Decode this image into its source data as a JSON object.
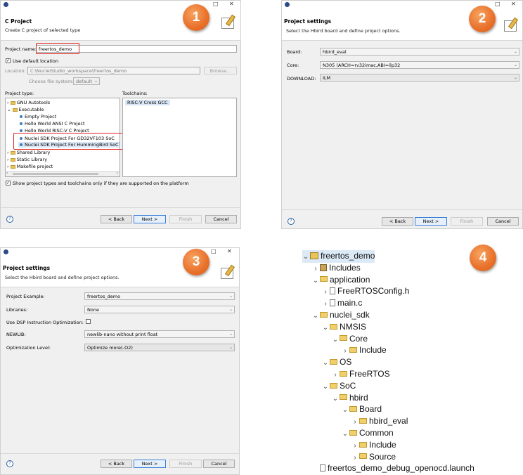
{
  "badges": [
    "1",
    "2",
    "3",
    "4"
  ],
  "window_buttons": {
    "minimize": "□",
    "close": "✕"
  },
  "panel1": {
    "title": "C Project",
    "description": "Create C project of selected type",
    "project_name_label": "Project name:",
    "project_name_value": "freertos_demo",
    "use_default_location_label": "Use default location",
    "use_default_location_checked": true,
    "location_label": "Location:",
    "location_value": "C:\\NucleiStudio_workspace\\freertos_demo",
    "browse_label": "Browse...",
    "choose_fs_label": "Choose file system:",
    "choose_fs_value": "default",
    "project_type_label": "Project type:",
    "toolchains_label": "Toolchains:",
    "project_types": [
      {
        "label": "GNU Autotools",
        "kind": "folder",
        "twisty": "›"
      },
      {
        "label": "Executable",
        "kind": "folder",
        "twisty": "⌄"
      },
      {
        "label": "Empty Project",
        "kind": "item"
      },
      {
        "label": "Hello World ANSI C Project",
        "kind": "item"
      },
      {
        "label": "Hello World RISC-V C Project",
        "kind": "item"
      },
      {
        "label": "Nuclei SDK Project For GD32VF103 SoC",
        "kind": "item"
      },
      {
        "label": "Nuclei SDK Project For HummingBird SoC",
        "kind": "item"
      },
      {
        "label": "Shared Library",
        "kind": "folder",
        "twisty": "›"
      },
      {
        "label": "Static Library",
        "kind": "folder",
        "twisty": "›"
      },
      {
        "label": "Makefile project",
        "kind": "folder",
        "twisty": "›"
      }
    ],
    "toolchains": [
      "RISC-V Cross GCC"
    ],
    "show_supported_label": "Show project types and toolchains only if they are supported on the platform",
    "show_supported_checked": true
  },
  "buttons": {
    "back": "< Back",
    "next": "Next >",
    "finish": "Finish",
    "cancel": "Cancel",
    "help": "?"
  },
  "panel2": {
    "title": "Project settings",
    "description": "Select the Hbird board and define project options.",
    "fields": [
      {
        "label": "Board:",
        "value": "hbird_eval"
      },
      {
        "label": "Core:",
        "value": "N305 (ARCH=rv32imac,ABI=ilp32"
      },
      {
        "label": "DOWNLOAD:",
        "value": "ILM"
      }
    ]
  },
  "panel3": {
    "title": "Project settings",
    "description": "Select the Hbird board and define project options.",
    "project_example_label": "Project Example:",
    "project_example_value": "freertos_demo",
    "libraries_label": "Libraries:",
    "libraries_value": "None",
    "dsp_label": "Use DSP Instruction Optimization:",
    "dsp_checked": false,
    "newlib_label": "NEWLIB:",
    "newlib_value": "newlib-nano without print float",
    "opt_label": "Optimization Level:",
    "opt_value": "Optimize more(-O2)"
  },
  "panel4": {
    "tree": [
      {
        "label": "freertos_demo",
        "icon": "project",
        "twisty": "⌄",
        "depth": 0
      },
      {
        "label": "Includes",
        "icon": "includes",
        "twisty": "›",
        "depth": 1
      },
      {
        "label": "application",
        "icon": "folder",
        "twisty": "⌄",
        "depth": 1
      },
      {
        "label": "FreeRTOSConfig.h",
        "icon": "file",
        "twisty": "›",
        "depth": 2
      },
      {
        "label": "main.c",
        "icon": "file",
        "twisty": "›",
        "depth": 2
      },
      {
        "label": "nuclei_sdk",
        "icon": "folder",
        "twisty": "⌄",
        "depth": 1
      },
      {
        "label": "NMSIS",
        "icon": "folder",
        "twisty": "⌄",
        "depth": 2
      },
      {
        "label": "Core",
        "icon": "folder",
        "twisty": "⌄",
        "depth": 3
      },
      {
        "label": "Include",
        "icon": "folder",
        "twisty": "›",
        "depth": 4
      },
      {
        "label": "OS",
        "icon": "folder",
        "twisty": "⌄",
        "depth": 2
      },
      {
        "label": "FreeRTOS",
        "icon": "folder",
        "twisty": "›",
        "depth": 3
      },
      {
        "label": "SoC",
        "icon": "folder",
        "twisty": "⌄",
        "depth": 2
      },
      {
        "label": "hbird",
        "icon": "folder",
        "twisty": "⌄",
        "depth": 3
      },
      {
        "label": "Board",
        "icon": "folder",
        "twisty": "⌄",
        "depth": 4
      },
      {
        "label": "hbird_eval",
        "icon": "folder",
        "twisty": "›",
        "depth": 5
      },
      {
        "label": "Common",
        "icon": "folder",
        "twisty": "⌄",
        "depth": 4
      },
      {
        "label": "Include",
        "icon": "folder",
        "twisty": "›",
        "depth": 5
      },
      {
        "label": "Source",
        "icon": "folder",
        "twisty": "›",
        "depth": 5
      },
      {
        "label": "freertos_demo_debug_openocd.launch",
        "icon": "file",
        "twisty": "",
        "depth": 1
      }
    ]
  }
}
